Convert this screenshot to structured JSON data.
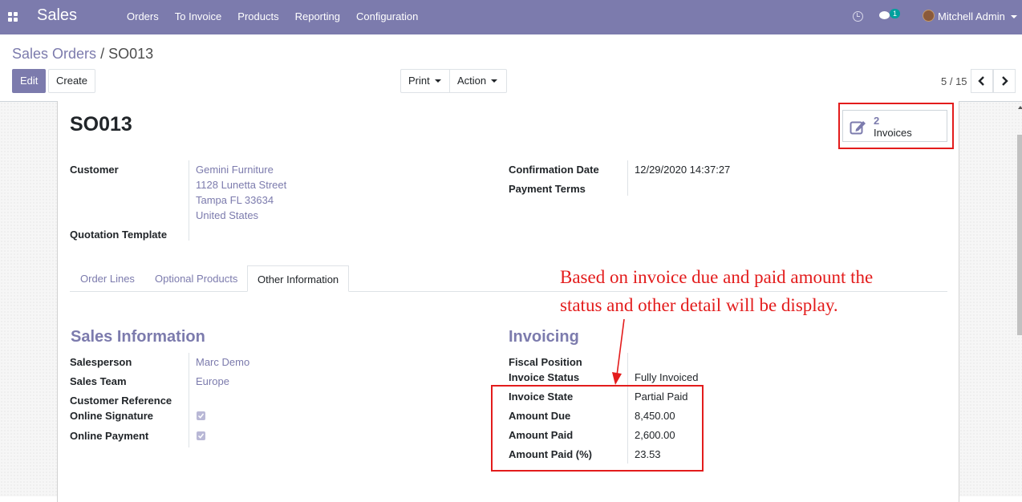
{
  "navbar": {
    "app_name": "Sales",
    "menu": [
      "Orders",
      "To Invoice",
      "Products",
      "Reporting",
      "Configuration"
    ],
    "chat_badge": "1",
    "user_name": "Mitchell Admin",
    "accent_color": "#7c7bad"
  },
  "breadcrumb": {
    "parent": "Sales Orders",
    "separator": "/",
    "current": "SO013"
  },
  "buttons": {
    "edit": "Edit",
    "create": "Create",
    "print": "Print",
    "action": "Action"
  },
  "pager": {
    "value": "5 / 15"
  },
  "record": {
    "title": "SO013",
    "smart_button": {
      "count": "2",
      "label": "Invoices"
    },
    "customer_label": "Customer",
    "customer_lines": [
      "Gemini Furniture",
      "1128 Lunetta Street",
      "Tampa FL 33634",
      "United States"
    ],
    "quotation_template_label": "Quotation Template",
    "confirmation_date_label": "Confirmation Date",
    "confirmation_date": "12/29/2020 14:37:27",
    "payment_terms_label": "Payment Terms"
  },
  "tabs": [
    "Order Lines",
    "Optional Products",
    "Other Information"
  ],
  "sales_info": {
    "title": "Sales Information",
    "salesperson_label": "Salesperson",
    "salesperson": "Marc Demo",
    "sales_team_label": "Sales Team",
    "sales_team": "Europe",
    "customer_reference_label": "Customer Reference",
    "online_signature_label": "Online Signature",
    "online_signature": true,
    "online_payment_label": "Online Payment",
    "online_payment": true
  },
  "invoicing": {
    "title": "Invoicing",
    "fiscal_position_label": "Fiscal Position",
    "invoice_status_label": "Invoice Status",
    "invoice_status": "Fully Invoiced",
    "invoice_state_label": "Invoice State",
    "invoice_state": "Partial Paid",
    "amount_due_label": "Amount Due",
    "amount_due": "8,450.00",
    "amount_paid_label": "Amount Paid",
    "amount_paid": "2,600.00",
    "amount_paid_pct_label": "Amount Paid (%)",
    "amount_paid_pct": "23.53"
  },
  "annotation": {
    "line1": "Based on invoice due and paid amount the",
    "line2": "status and other detail will be display.",
    "color": "#e31c1c"
  }
}
